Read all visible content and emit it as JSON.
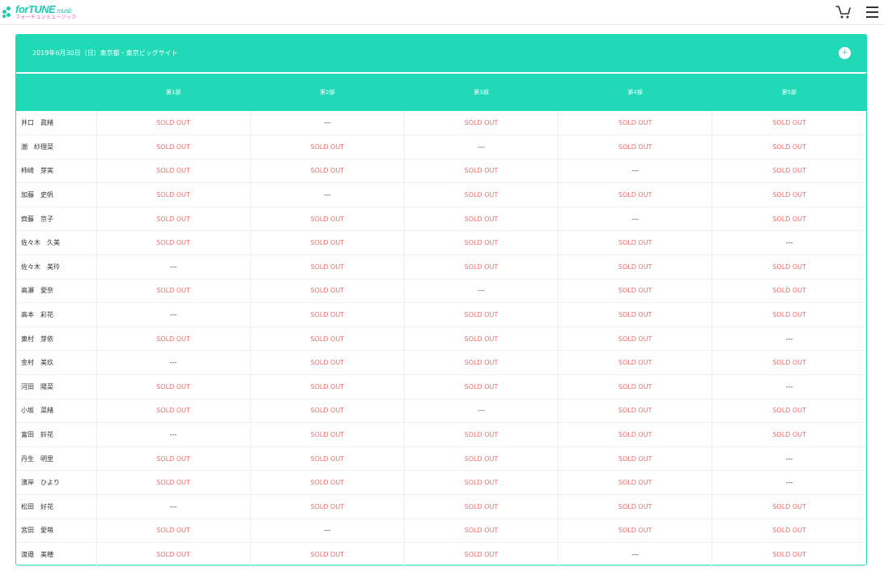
{
  "header": {
    "logo_main": "forTUNE",
    "logo_music": "music",
    "logo_sub": "フォーチュンミュージック",
    "cart_icon": "cart-icon",
    "menu_icon": "hamburger-menu-icon"
  },
  "colors": {
    "accent": "#1fd9b7",
    "sold_out": "#f16b6b",
    "logo_pink": "#e0559c"
  },
  "event": {
    "title": "2019年6月30日（日）東京都・東京ビッグサイト",
    "toggle_icon": "plus-circle-icon"
  },
  "table": {
    "headers": [
      "",
      "第1部",
      "第2部",
      "第3部",
      "第4部",
      "第5部"
    ],
    "rows": [
      {
        "name": "井口　眞緒",
        "slots": [
          "SOLD OUT",
          "---",
          "SOLD OUT",
          "SOLD OUT",
          "SOLD OUT"
        ]
      },
      {
        "name": "潮　紗理菜",
        "slots": [
          "SOLD OUT",
          "SOLD OUT",
          "---",
          "SOLD OUT",
          "SOLD OUT"
        ]
      },
      {
        "name": "柿崎　芽実",
        "slots": [
          "SOLD OUT",
          "SOLD OUT",
          "SOLD OUT",
          "---",
          "SOLD OUT"
        ]
      },
      {
        "name": "加藤　史帆",
        "slots": [
          "SOLD OUT",
          "---",
          "SOLD OUT",
          "SOLD OUT",
          "SOLD OUT"
        ]
      },
      {
        "name": "齊藤　京子",
        "slots": [
          "SOLD OUT",
          "SOLD OUT",
          "SOLD OUT",
          "---",
          "SOLD OUT"
        ]
      },
      {
        "name": "佐々木　久美",
        "slots": [
          "SOLD OUT",
          "SOLD OUT",
          "SOLD OUT",
          "SOLD OUT",
          "---"
        ]
      },
      {
        "name": "佐々木　美玲",
        "slots": [
          "---",
          "SOLD OUT",
          "SOLD OUT",
          "SOLD OUT",
          "SOLD OUT"
        ]
      },
      {
        "name": "高瀬　愛奈",
        "slots": [
          "SOLD OUT",
          "SOLD OUT",
          "---",
          "SOLD OUT",
          "SOLD OUT"
        ]
      },
      {
        "name": "高本　彩花",
        "slots": [
          "---",
          "SOLD OUT",
          "SOLD OUT",
          "SOLD OUT",
          "SOLD OUT"
        ]
      },
      {
        "name": "東村　芽依",
        "slots": [
          "SOLD OUT",
          "SOLD OUT",
          "SOLD OUT",
          "SOLD OUT",
          "---"
        ]
      },
      {
        "name": "金村　美玖",
        "slots": [
          "---",
          "SOLD OUT",
          "SOLD OUT",
          "SOLD OUT",
          "SOLD OUT"
        ]
      },
      {
        "name": "河田　陽菜",
        "slots": [
          "SOLD OUT",
          "SOLD OUT",
          "SOLD OUT",
          "SOLD OUT",
          "---"
        ]
      },
      {
        "name": "小坂　菜緒",
        "slots": [
          "SOLD OUT",
          "SOLD OUT",
          "---",
          "SOLD OUT",
          "SOLD OUT"
        ]
      },
      {
        "name": "富田　鈴花",
        "slots": [
          "---",
          "SOLD OUT",
          "SOLD OUT",
          "SOLD OUT",
          "SOLD OUT"
        ]
      },
      {
        "name": "丹生　明里",
        "slots": [
          "SOLD OUT",
          "SOLD OUT",
          "SOLD OUT",
          "SOLD OUT",
          "---"
        ]
      },
      {
        "name": "濱岸　ひより",
        "slots": [
          "SOLD OUT",
          "SOLD OUT",
          "SOLD OUT",
          "SOLD OUT",
          "---"
        ]
      },
      {
        "name": "松田　好花",
        "slots": [
          "---",
          "SOLD OUT",
          "SOLD OUT",
          "SOLD OUT",
          "SOLD OUT"
        ]
      },
      {
        "name": "宮田　愛萌",
        "slots": [
          "SOLD OUT",
          "---",
          "SOLD OUT",
          "SOLD OUT",
          "SOLD OUT"
        ]
      },
      {
        "name": "渡邉　美穂",
        "slots": [
          "SOLD OUT",
          "SOLD OUT",
          "SOLD OUT",
          "---",
          "SOLD OUT"
        ]
      }
    ]
  }
}
